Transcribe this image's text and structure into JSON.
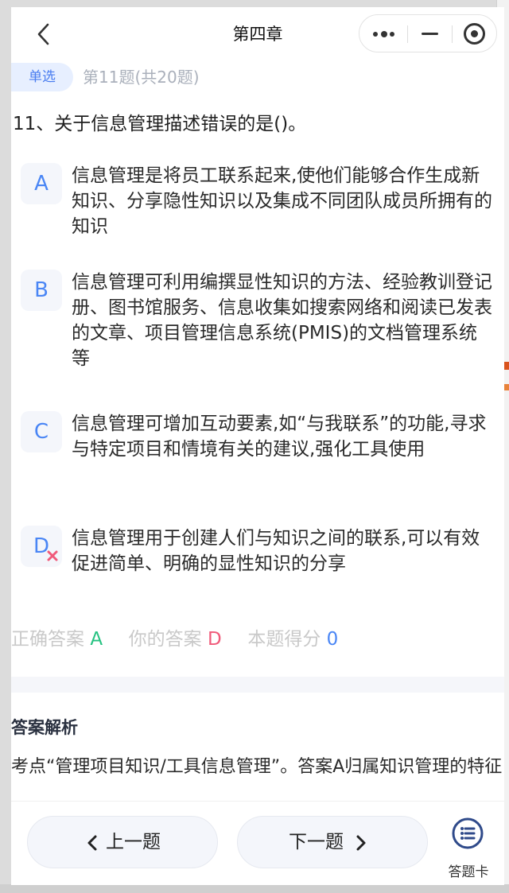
{
  "navbar": {
    "title": "第四章",
    "back_icon": "chevron-left-icon",
    "more_icon": "more-dots-icon",
    "minimize_icon": "minimize-icon",
    "close_icon": "target-close-icon"
  },
  "question": {
    "type_label": "单选",
    "progress_label": "第11题(共20题)",
    "text": "11、关于信息管理描述错误的是()。"
  },
  "options": [
    {
      "letter": "A",
      "text": "信息管理是将员工联系起来,使他们能够合作生成新知识、分享隐性知识以及集成不同团队成员所拥有的知识"
    },
    {
      "letter": "B",
      "text": "信息管理可利用编撰显性知识的方法、经验教训登记册、图书馆服务、信息收集如搜索网络和阅读已发表的文章、项目管理信息系统(PMIS)的文档管理系统等"
    },
    {
      "letter": "C",
      "text": "信息管理可增加互动要素,如“与我联系”的功能,寻求与特定项目和情境有关的建议,强化工具使用"
    },
    {
      "letter": "D",
      "text": "信息管理用于创建人们与知识之间的联系,可以有效促进简单、明确的显性知识的分享",
      "wrong_icon": "wrong-x-icon"
    }
  ],
  "result": {
    "correct_label": "正确答案",
    "correct_value": "A",
    "yours_label": "你的答案",
    "yours_value": "D",
    "score_label": "本题得分",
    "score_value": "0"
  },
  "analysis": {
    "title": "答案解析",
    "text": "考点“管理项目知识/工具信息管理”。答案A归属知识管理的特征"
  },
  "bottom": {
    "prev_label": "上一题",
    "next_label": "下一题",
    "card_label": "答题卡",
    "card_icon": "list-circle-icon"
  },
  "colors": {
    "accent": "#4a86f5",
    "correct": "#26c281",
    "wrong": "#f05a7a"
  }
}
